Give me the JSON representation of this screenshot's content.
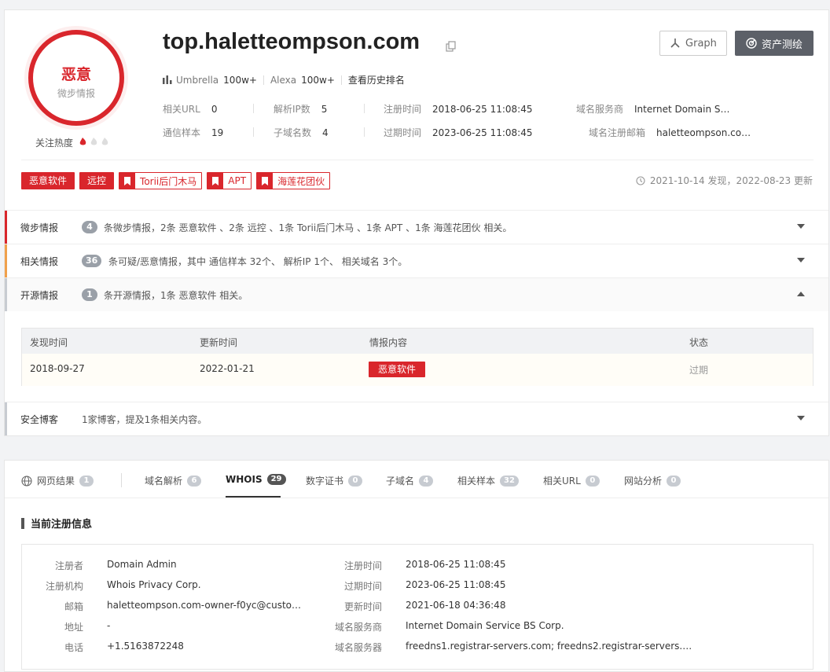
{
  "badge": {
    "label": "恶意",
    "sub": "微步情报",
    "heat_label": "关注热度"
  },
  "domain": "top.haletteompson.com",
  "buttons": {
    "graph": "Graph",
    "asset": "资产测绘"
  },
  "rank": {
    "umbrella_label": "Umbrella",
    "umbrella_value": "100w+",
    "alexa_label": "Alexa",
    "alexa_value": "100w+",
    "history": "查看历史排名"
  },
  "stats": {
    "url_label": "相关URL",
    "url_value": "0",
    "ip_label": "解析IP数",
    "ip_value": "5",
    "reg_time_label": "注册时间",
    "reg_time_value": "2018-06-25 11:08:45",
    "ns_label": "域名服务商",
    "ns_value": "Internet Domain S…",
    "sample_label": "通信样本",
    "sample_value": "19",
    "sub_label": "子域名数",
    "sub_value": "4",
    "exp_label": "过期时间",
    "exp_value": "2023-06-25 11:08:45",
    "email_label": "域名注册邮箱",
    "email_value": "haletteompson.co…"
  },
  "tags": {
    "t1": "恶意软件",
    "t2": "远控",
    "t3": "Torii后门木马",
    "t4": "APT",
    "t5": "海莲花团伙"
  },
  "found": "2021-10-14 发现，2022-08-23 更新",
  "intel": {
    "r1_label": "微步情报",
    "r1_count": "4",
    "r1_text": "条微步情报，2条 恶意软件 、2条 远控 、1条 Torii后门木马 、1条 APT 、1条 海莲花团伙 相关。",
    "r2_label": "相关情报",
    "r2_count": "36",
    "r2_text": "条可疑/恶意情报，其中 通信样本 32个、 解析IP 1个、 相关域名 3个。",
    "r3_label": "开源情报",
    "r3_count": "1",
    "r3_text": "条开源情报，1条 恶意软件 相关。",
    "r4_label": "安全博客",
    "r4_text": "1家博客，提及1条相关内容。"
  },
  "os_table": {
    "h1": "发现时间",
    "h2": "更新时间",
    "h3": "情报内容",
    "h4": "状态",
    "c1": "2018-09-27",
    "c2": "2022-01-21",
    "c3": "恶意软件",
    "c4": "过期"
  },
  "tabs": {
    "t1": "网页结果",
    "n1": "1",
    "t2": "域名解析",
    "n2": "6",
    "t3": "WHOIS",
    "n3": "29",
    "t4": "数字证书",
    "n4": "0",
    "t5": "子域名",
    "n5": "4",
    "t6": "相关样本",
    "n6": "32",
    "t7": "相关URL",
    "n7": "0",
    "t8": "网站分析",
    "n8": "0"
  },
  "whois": {
    "title": "当前注册信息",
    "registrant_label": "注册者",
    "registrant": "Domain Admin",
    "org_label": "注册机构",
    "org": "Whois Privacy Corp.",
    "email_label": "邮箱",
    "email": "haletteompson.com-owner-f0yc@custo…",
    "addr_label": "地址",
    "addr": "-",
    "phone_label": "电话",
    "phone": "+1.5163872248",
    "reg_label": "注册时间",
    "reg": "2018-06-25 11:08:45",
    "exp_label": "过期时间",
    "exp": "2023-06-25 11:08:45",
    "upd_label": "更新时间",
    "upd": "2021-06-18 04:36:48",
    "ns_label": "域名服务商",
    "ns": "Internet Domain Service BS Corp.",
    "nsrv_label": "域名服务器",
    "nsrv": "freedns1.registrar-servers.com; freedns2.registrar-servers.com; fr…"
  },
  "colors": {
    "danger": "#d9262c",
    "warn": "#f0a04b",
    "neutral": "#c7cbd1"
  }
}
